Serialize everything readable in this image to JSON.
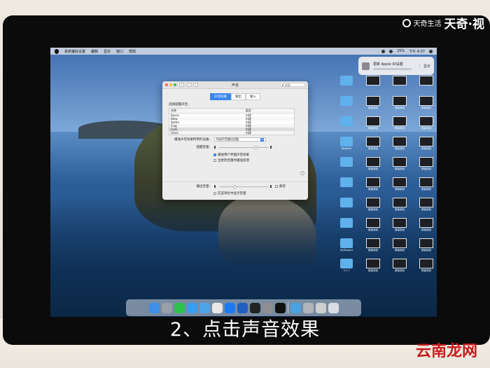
{
  "watermark_top": {
    "main": "天奇·视",
    "sub": "天奇生活"
  },
  "watermark_bottom": "云南龙网",
  "subtitle": "2、点击声音效果",
  "menubar": {
    "items": [
      "系统偏好设置",
      "编辑",
      "显示",
      "窗口",
      "帮助"
    ],
    "battery": "25%",
    "clock": "下午 4:37"
  },
  "notification": {
    "title": "更新 Apple ID设置",
    "detail": "显示"
  },
  "window": {
    "title": "声音",
    "search_placeholder": "搜索",
    "tabs": [
      {
        "label": "声音效果",
        "active": true
      },
      {
        "label": "输出",
        "active": false
      },
      {
        "label": "输入",
        "active": false
      }
    ],
    "select_alert_label": "选择提醒声音：",
    "table_headers": {
      "name": "名称",
      "type": "类型"
    },
    "sounds": [
      {
        "name": "Basso",
        "type": "内建"
      },
      {
        "name": "Blow",
        "type": "内建"
      },
      {
        "name": "Bottle",
        "type": "内建"
      },
      {
        "name": "Frog",
        "type": "内建"
      },
      {
        "name": "Funk",
        "type": "内建"
      },
      {
        "name": "Glass",
        "type": "内建"
      }
    ],
    "selected_sound": "Funk",
    "play_device_label": "播放声音效果所用的设备：",
    "play_device_value": "所选声音输出设备",
    "alert_volume_label": "提醒音量：",
    "checkbox_ui_sounds": "播放用户界面声音效果",
    "checkbox_feedback": "当更改音量时播放反馈",
    "output_volume_label": "输出音量：",
    "mute_label": "静音",
    "checkbox_menubar": "在菜单栏中显示音量"
  },
  "desktop_icons": [
    "",
    "",
    "",
    "",
    "",
    "屏幕录制",
    "屏幕录制",
    "屏幕录制",
    "",
    "屏幕录制",
    "屏幕录制",
    "屏幕录制",
    "Weather",
    "屏幕录制",
    "屏幕录制",
    "屏幕录制",
    "",
    "屏幕录制",
    "屏幕录制",
    "屏幕录制",
    "",
    "屏幕录制",
    "屏幕录制",
    "屏幕录制",
    "",
    "屏幕录制",
    "屏幕录制",
    "屏幕录制",
    "",
    "屏幕录制",
    "屏幕录制",
    "屏幕录制",
    "JSQProject",
    "屏幕录制",
    "屏幕录制",
    "屏幕录制",
    "4.1.7",
    "屏幕录制",
    "屏幕录制",
    "屏幕录制"
  ]
}
